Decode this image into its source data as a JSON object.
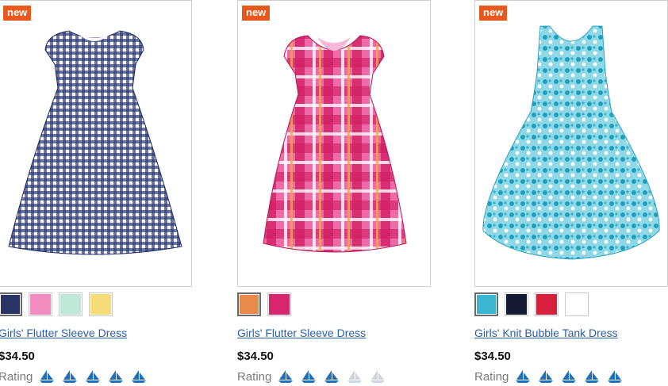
{
  "products": [
    {
      "badge": "new",
      "title": "Girls' Flutter Sleeve Dress",
      "price": "$34.50",
      "rating_label": "Rating",
      "rating": 5,
      "rating_max": 5,
      "dress_color": "#1e2a5e",
      "swatches": [
        {
          "name": "navy-gingham",
          "color": "#2b3468",
          "selected": true
        },
        {
          "name": "pink-gingham",
          "color": "#f28cc0",
          "selected": false
        },
        {
          "name": "mint-gingham",
          "color": "#bfe8d8",
          "selected": false
        },
        {
          "name": "yellow-gingham",
          "color": "#f7dc7a",
          "selected": false
        }
      ]
    },
    {
      "badge": "new",
      "title": "Girls' Flutter Sleeve Dress",
      "price": "$34.50",
      "rating_label": "Rating",
      "rating": 3,
      "rating_max": 5,
      "dress_color": "#e23f8c",
      "swatches": [
        {
          "name": "orange-pink-plaid",
          "color": "#e88a4a",
          "selected": true
        },
        {
          "name": "magenta-plaid",
          "color": "#d9256e",
          "selected": false
        }
      ]
    },
    {
      "badge": "new",
      "title": "Girls' Knit Bubble Tank Dress",
      "price": "$34.50",
      "rating_label": "Rating",
      "rating": 5,
      "rating_max": 5,
      "dress_color": "#5cc6d8",
      "swatches": [
        {
          "name": "aqua-print",
          "color": "#3bb5d1",
          "selected": true
        },
        {
          "name": "navy",
          "color": "#141a33",
          "selected": false
        },
        {
          "name": "red-print",
          "color": "#d8203e",
          "selected": false
        },
        {
          "name": "white",
          "color": "#ffffff",
          "selected": false
        }
      ]
    }
  ]
}
